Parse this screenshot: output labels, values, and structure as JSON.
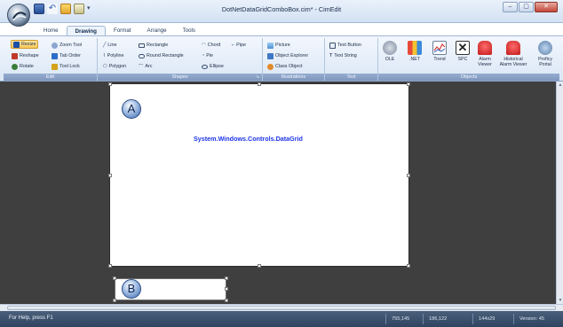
{
  "window": {
    "title": "DotNetDataGridComboBox.cim* - CimEdit",
    "controls": [
      "–",
      "▢",
      "✕"
    ]
  },
  "quick_access": {
    "more": "▾"
  },
  "tabs": [
    "Home",
    "Drawing",
    "Format",
    "Arrange",
    "Tools"
  ],
  "active_tab": "Drawing",
  "ribbon": {
    "edit": {
      "label": "Edit",
      "items": [
        "Resize",
        "Zoom Tool",
        "Reshape",
        "Tab Order",
        "Rotate",
        "Tool Lock"
      ]
    },
    "shapes": {
      "label": "Shapes",
      "items": [
        "Line",
        "Rectangle",
        "Chord",
        "Pipe",
        "Polyline",
        "Round Rectangle",
        "Pie",
        "Polygon",
        "Arc",
        "Ellipse"
      ]
    },
    "illustrations": {
      "label": "Illustrations",
      "items": [
        "Picture",
        "Object Explorer",
        "Class Object"
      ]
    },
    "text": {
      "label": "Text",
      "items": [
        "Text Button",
        "Text String"
      ]
    },
    "objects": {
      "label": "Objects",
      "items": [
        "OLE",
        ".NET",
        "Trend",
        "SPC",
        "Alarm Viewer",
        "Historical Alarm Viewer",
        "Proficy Portal"
      ]
    }
  },
  "canvas": {
    "datagrid_text": "System.Windows.Controls.DataGrid",
    "marker_a": "A",
    "marker_b": "B"
  },
  "status": {
    "help": "For Help, press F1",
    "cells": [
      "755,145",
      "186,122",
      "144x29",
      "Version: 45"
    ]
  },
  "colors": {
    "workspace": "#3f3f3f",
    "datagrid_text": "#1c34e8",
    "status_bar": "#3b5170",
    "selected_tool": "#f8c75a"
  }
}
